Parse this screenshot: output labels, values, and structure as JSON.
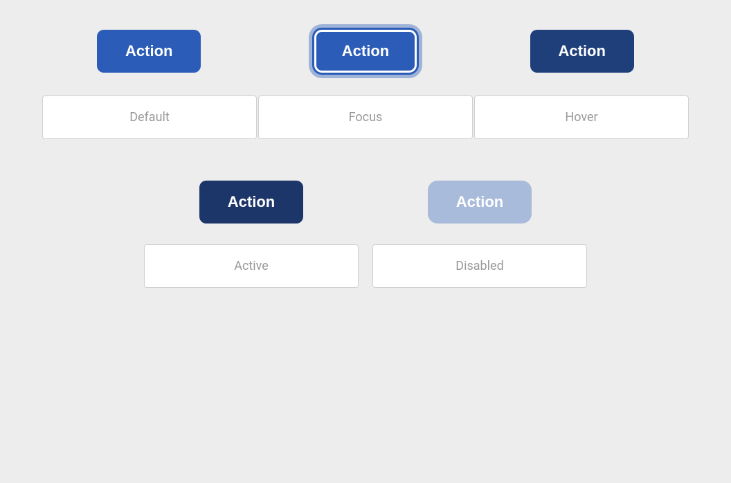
{
  "page": {
    "background": "#EDEDED"
  },
  "row1": {
    "buttons": [
      {
        "id": "default",
        "label": "Action",
        "state": "Default"
      },
      {
        "id": "focus",
        "label": "Action",
        "state": "Focus"
      },
      {
        "id": "hover",
        "label": "Action",
        "state": "Hover"
      }
    ]
  },
  "row2": {
    "buttons": [
      {
        "id": "active",
        "label": "Action",
        "state": "Active"
      },
      {
        "id": "disabled",
        "label": "Action",
        "state": "Disabled"
      }
    ]
  }
}
